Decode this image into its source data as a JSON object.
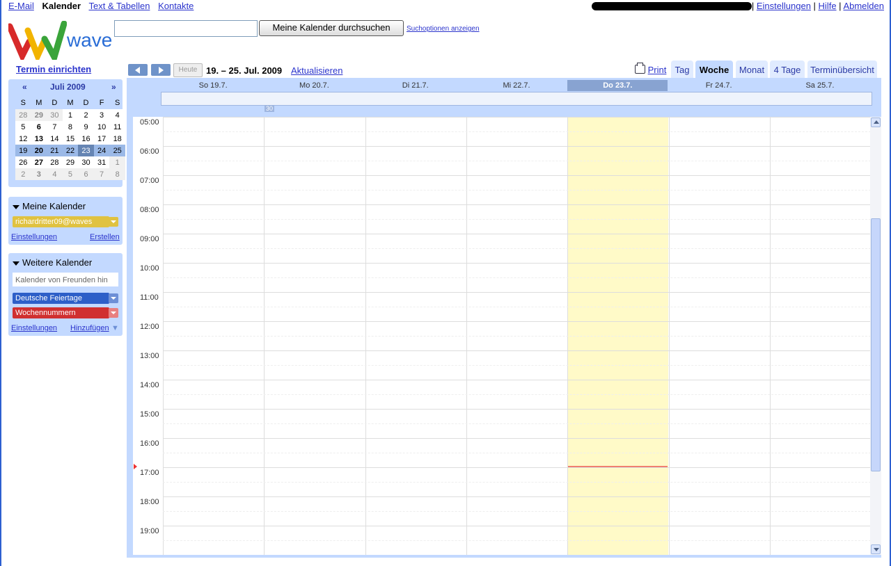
{
  "nav": {
    "mail": "E-Mail",
    "calendar": "Kalender",
    "docs": "Text & Tabellen",
    "contacts": "Kontakte"
  },
  "account": {
    "settings": "Einstellungen",
    "help": "Hilfe",
    "logout": "Abmelden"
  },
  "logo": {
    "text": "wave"
  },
  "search": {
    "value": "",
    "button": "Meine Kalender durchsuchen",
    "options": "Suchoptionen anzeigen"
  },
  "sidebar": {
    "new_event": "Termin einrichten",
    "minical": {
      "prev": "«",
      "next": "»",
      "month": "Juli 2009",
      "weekdays": [
        "S",
        "M",
        "D",
        "M",
        "D",
        "F",
        "S"
      ],
      "weeks": [
        [
          "28",
          "29",
          "30",
          "1",
          "2",
          "3",
          "4"
        ],
        [
          "5",
          "6",
          "7",
          "8",
          "9",
          "10",
          "11"
        ],
        [
          "12",
          "13",
          "14",
          "15",
          "16",
          "17",
          "18"
        ],
        [
          "19",
          "20",
          "21",
          "22",
          "23",
          "24",
          "25"
        ],
        [
          "26",
          "27",
          "28",
          "29",
          "30",
          "31",
          "1"
        ],
        [
          "2",
          "3",
          "4",
          "5",
          "6",
          "7",
          "8"
        ]
      ]
    },
    "my_calendars": {
      "title": "Meine Kalender",
      "items": [
        {
          "label": "richardritter09@waves",
          "color": "#e0c240"
        }
      ],
      "settings": "Einstellungen",
      "create": "Erstellen"
    },
    "other_calendars": {
      "title": "Weitere Kalender",
      "input_placeholder": "Kalender von Freunden hin",
      "items": [
        {
          "label": "Deutsche Feiertage",
          "color": "#2d5fc8"
        },
        {
          "label": "Wochennummern",
          "color": "#d03030"
        }
      ],
      "settings": "Einstellungen",
      "add": "Hinzufügen"
    }
  },
  "toolbar": {
    "today": "Heute",
    "range": "19. – 25. Jul. 2009",
    "refresh": "Aktualisieren",
    "print": "Print",
    "views": [
      "Tag",
      "Woche",
      "Monat",
      "4 Tage",
      "Terminübersicht"
    ],
    "active_view": "Woche"
  },
  "week": {
    "days": [
      "So 19.7.",
      "Mo 20.7.",
      "Di 21.7.",
      "Mi 22.7.",
      "Do 23.7.",
      "Fr 24.7.",
      "Sa 25.7."
    ],
    "today_index": 4,
    "week_number": "30",
    "hours": [
      "05:00",
      "06:00",
      "07:00",
      "08:00",
      "09:00",
      "10:00",
      "11:00",
      "12:00",
      "13:00",
      "14:00",
      "15:00",
      "16:00",
      "17:00",
      "18:00",
      "19:00"
    ]
  },
  "colors": {
    "accent": "#c3d9ff",
    "today_col": "#fffac8",
    "link": "#2a33cc"
  }
}
